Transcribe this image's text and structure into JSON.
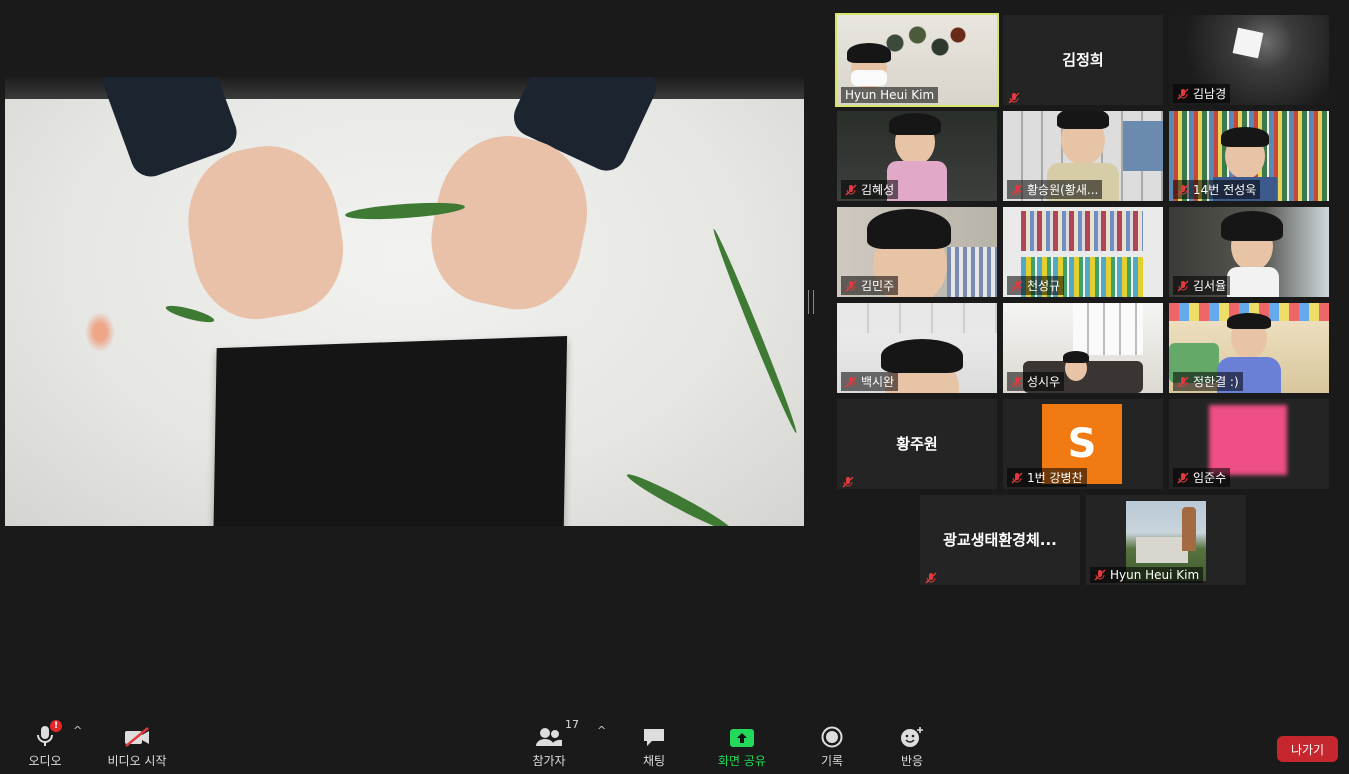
{
  "gallery": [
    {
      "name": "Hyun Heui Kim",
      "show_center_name": false,
      "active": true,
      "scene": "host"
    },
    {
      "name": "김정희",
      "show_center_name": true,
      "scene": "blank"
    },
    {
      "name": "김남경",
      "show_center_name": false,
      "scene": "dark"
    },
    {
      "name": "김혜성",
      "show_center_name": false,
      "scene": "kid-sofa"
    },
    {
      "name": "황승원(황새...",
      "show_center_name": false,
      "scene": "kid-shelf"
    },
    {
      "name": "14번 전성욱",
      "show_center_name": false,
      "scene": "kid-books"
    },
    {
      "name": "김민주",
      "show_center_name": false,
      "scene": "kid-close"
    },
    {
      "name": "천성규",
      "show_center_name": false,
      "scene": "bookshelf"
    },
    {
      "name": "김서율",
      "show_center_name": false,
      "scene": "kid-girl"
    },
    {
      "name": "백시완",
      "show_center_name": false,
      "scene": "kid-low"
    },
    {
      "name": "성시우",
      "show_center_name": false,
      "scene": "room"
    },
    {
      "name": "정한결 :)",
      "show_center_name": false,
      "scene": "kid-room"
    },
    {
      "name": "황주원",
      "show_center_name": true,
      "scene": "blank-muted"
    },
    {
      "name": "1번 강병찬",
      "show_center_name": false,
      "scene": "avatar",
      "avatar_letter": "S",
      "avatar_color": "#f27a12"
    },
    {
      "name": "임준수",
      "show_center_name": false,
      "scene": "pink"
    },
    {
      "name": "광교생태환경체...",
      "show_center_name": true,
      "scene": "blank-muted"
    },
    {
      "name": "Hyun Heui Kim",
      "show_center_name": false,
      "scene": "building"
    }
  ],
  "toolbar": {
    "audio": "오디오",
    "audio_badge": "!",
    "video": "비디오 시작",
    "participants": "참가자",
    "participants_count": "17",
    "chat": "채팅",
    "share": "화면 공유",
    "record": "기록",
    "reactions": "반응",
    "leave": "나가기"
  },
  "colors": {
    "active_border": "#d7e36a",
    "share_green": "#23d959",
    "leave_red": "#c6262e",
    "mute_red": "#e0393e"
  }
}
